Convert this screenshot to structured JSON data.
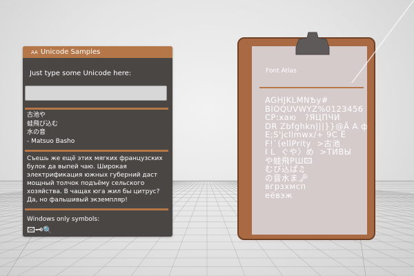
{
  "panel": {
    "title": "Unicode Samples",
    "prompt": "Just type some Unicode here:",
    "input_value": "",
    "haiku": "古池や\n蛙飛び込む\n水の音\n- Matsuo Basho",
    "russian": "Съешь же ещё этих мягких французских булок да выпей чаю. Широкая электрификация южных губерний даст мощный толчок подъёму сельского хозяйства. В чащах юга жил бы цитрус? Да, но фальшивый экземпляр!",
    "symbols_label": "Windows only symbols:",
    "symbols": "🖾🗝🔍"
  },
  "atlas": {
    "title": "Font Atlas",
    "glyphs": "AGHJKLMNѢy#\nBIOQUVWYZ%0123456\nCP:хаю   ?ЯЦПЧИ\nDR Zbfghkn|||}}@Ä A ф\nE;S'jcllmwx/+ 9C Ё\nF!`(ellPrity  >古池\nI L  ぐや〉め  >ТИВЫ\nや蛙飛РШ🖾\nむび込ぱ♫\nの音水ま🗝\nвгрзхмсп\nеёвэж"
  },
  "colors": {
    "accent": "#b57648",
    "panel_bg": "#4a4644",
    "clipboard": "#a96a43",
    "paper": "#d5cbcb"
  }
}
